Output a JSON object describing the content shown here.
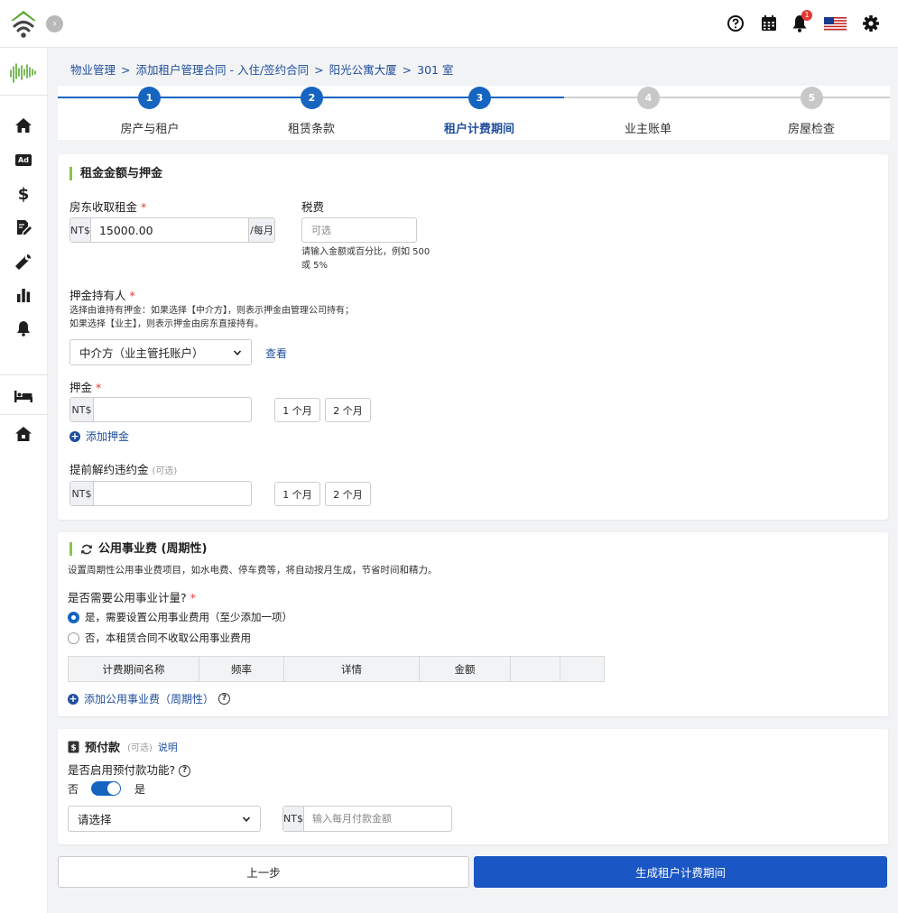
{
  "colors": {
    "accent": "#1565c0",
    "primary_button": "#1a56c4",
    "link": "#1f4e9c",
    "section_bar": "#8bc34a",
    "badge": "#e53935",
    "logo_green": "#5aa832"
  },
  "header": {
    "icons": [
      "wifi-house-logo",
      "chevron-right-icon",
      "help-circle-icon",
      "calendar-icon",
      "bell-icon",
      "us-flag-icon",
      "gear-icon"
    ],
    "notification_count": "1"
  },
  "sidebar": {
    "items": [
      "home-icon",
      "ad-icon",
      "dollar-icon",
      "contract-edit-icon",
      "wrench-icon",
      "bar-chart-icon",
      "bell-icon",
      "bed-icon",
      "house-icon"
    ],
    "ad_label": "Ad",
    "dollar_label": "$"
  },
  "breadcrumb": [
    "物业管理",
    "添加租户管理合同 - 入住/签约合同",
    "阳光公寓大厦",
    "301 室"
  ],
  "breadcrumb_separator": ">",
  "steps": [
    {
      "number": "1",
      "label": "房产与租户",
      "state": "done"
    },
    {
      "number": "2",
      "label": "租赁条款",
      "state": "done"
    },
    {
      "number": "3",
      "label": "租户计费期间",
      "state": "active"
    },
    {
      "number": "4",
      "label": "业主账单",
      "state": "pending"
    },
    {
      "number": "5",
      "label": "房屋检查",
      "state": "pending"
    }
  ],
  "rent_section": {
    "title": "租金金额与押金",
    "rent_label": "房东收取租金",
    "required_mark": "*",
    "currency": "NT$",
    "rent_value": "15000.00",
    "rent_unit": "/每月",
    "tax_label": "税费",
    "tax_placeholder": "可选",
    "tax_hint_line1": "请输入金额或百分比，例如 500",
    "tax_hint_line2": "或 5%",
    "holder_label": "押金持有人",
    "holder_hint_line1": "选择由谁持有押金：如果选择【中介方】，则表示押金由管理公司持有；",
    "holder_hint_line2": "如果选择【业主】，则表示押金由房东直接持有。",
    "holder_selected": "中介方（业主管托账户）",
    "view_link": "查看",
    "deposit_label": "押金",
    "deposit_value": "",
    "one_month": "1 个月",
    "two_months": "2 个月",
    "add_deposit": "添加押金",
    "penalty_label": "提前解约违约金",
    "optional_tag": "(可选)",
    "penalty_value": ""
  },
  "utility_section": {
    "title": "公用事业费 (周期性)",
    "description": "设置周期性公用事业费项目，如水电费、停车费等，将自动按月生成，节省时间和精力。",
    "question": "是否需要公用事业计量?",
    "required_mark": "*",
    "option_yes": "是，需要设置公用事业费用（至少添加一项）",
    "option_no": "否，本租赁合同不收取公用事业费用",
    "selected": "yes",
    "table_headers": [
      "计费期间名称",
      "频率",
      "详情",
      "金额",
      "",
      ""
    ],
    "add_link": "添加公用事业费（周期性）"
  },
  "prepay_section": {
    "title": "预付款",
    "optional_tag": "(可选)",
    "explain_link": "说明",
    "question": "是否启用预付款功能?",
    "toggle_off_label": "否",
    "toggle_on_label": "是",
    "toggle_on": true,
    "select_placeholder": "请选择",
    "currency": "NT$",
    "amount_placeholder": "输入每月付款金额"
  },
  "footer": {
    "prev_label": "上一步",
    "next_label": "生成租户计费期间"
  }
}
